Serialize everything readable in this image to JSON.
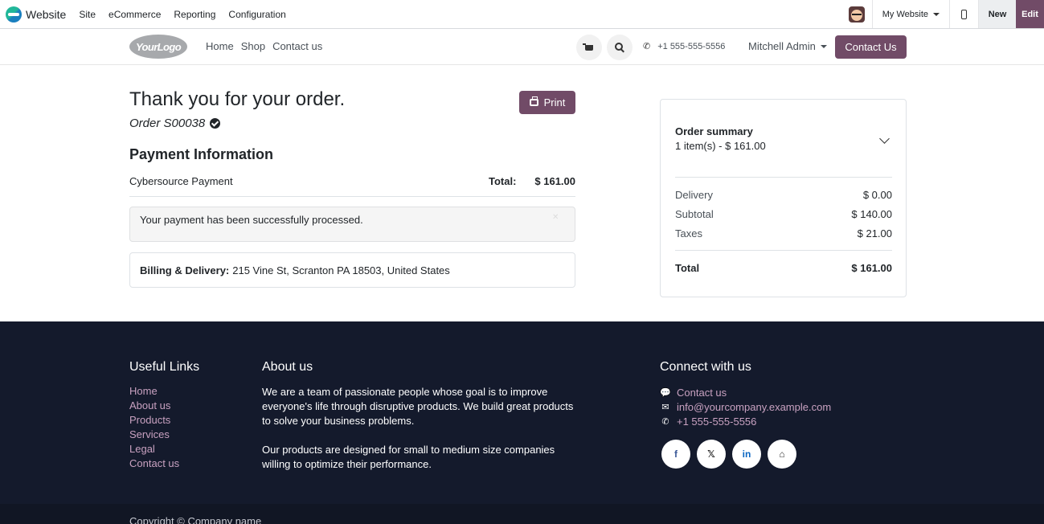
{
  "topbar": {
    "brand": "Website",
    "menu": [
      "Site",
      "eCommerce",
      "Reporting",
      "Configuration"
    ],
    "website_selector": "My Website",
    "new_label": "New",
    "edit_label": "Edit"
  },
  "header": {
    "logo_text": "YourLogo",
    "nav": [
      "Home",
      "Shop",
      "Contact us"
    ],
    "phone": "+1 555-555-5556",
    "user": "Mitchell Admin",
    "contact_button": "Contact Us"
  },
  "main": {
    "title": "Thank you for your order.",
    "order_ref": "Order S00038",
    "print_label": "Print",
    "payment_title": "Payment Information",
    "payment_method": "Cybersource Payment",
    "total_label": "Total:",
    "total_value": "$ 161.00",
    "success_message": "Your payment has been successfully processed.",
    "billing_label": "Billing & Delivery:",
    "billing_address": "215 Vine St, Scranton PA 18503, United States"
  },
  "summary": {
    "title": "Order summary",
    "items": "1 item(s) -  $ 161.00",
    "rows": [
      {
        "label": "Delivery",
        "value": "$ 0.00"
      },
      {
        "label": "Subtotal",
        "value": "$ 140.00"
      },
      {
        "label": "Taxes",
        "value": "$ 21.00"
      }
    ],
    "total_label": "Total",
    "total_value": "$ 161.00"
  },
  "footer": {
    "useful_links_title": "Useful Links",
    "useful_links": [
      "Home",
      "About us",
      "Products",
      "Services",
      "Legal",
      "Contact us"
    ],
    "about_title": "About us",
    "about_p1": "We are a team of passionate people whose goal is to improve everyone's life through disruptive products. We build great products to solve your business problems.",
    "about_p2": "Our products are designed for small to medium size companies willing to optimize their performance.",
    "connect_title": "Connect with us",
    "connect": [
      {
        "icon": "comment-icon",
        "label": "Contact us"
      },
      {
        "icon": "envelope-icon",
        "label": "info@yourcompany.example.com"
      },
      {
        "icon": "phone-icon",
        "label": "+1 555-555-5556"
      }
    ],
    "socials": [
      {
        "icon": "facebook-icon",
        "glyph": "f"
      },
      {
        "icon": "x-twitter-icon",
        "glyph": "𝕏"
      },
      {
        "icon": "linkedin-icon",
        "glyph": "in"
      },
      {
        "icon": "home-icon",
        "glyph": "⌂"
      }
    ],
    "copyright": "Copyright © Company name"
  },
  "colors": {
    "brand": "#714b67",
    "footer_bg": "#141a2c",
    "footer_link": "#c8a1c0"
  }
}
